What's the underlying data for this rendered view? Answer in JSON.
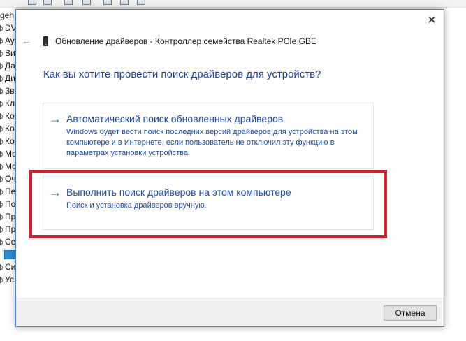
{
  "background": {
    "tree_items": [
      {
        "label": "gen",
        "icon": "none"
      },
      {
        "label": "DV",
        "icon": "chevron"
      },
      {
        "label": "Ay",
        "icon": "chevron"
      },
      {
        "label": "Ви",
        "icon": "chevron"
      },
      {
        "label": "Да",
        "icon": "chevron"
      },
      {
        "label": "Ди",
        "icon": "chevron"
      },
      {
        "label": "Зв",
        "icon": "chevron"
      },
      {
        "label": "Кл",
        "icon": "chevron"
      },
      {
        "label": "Ко",
        "icon": "chevron"
      },
      {
        "label": "Ко",
        "icon": "chevron"
      },
      {
        "label": "Ко",
        "icon": "chevron"
      },
      {
        "label": "Мо",
        "icon": "chevron"
      },
      {
        "label": "Мо",
        "icon": "chevron"
      },
      {
        "label": "Оч",
        "icon": "chevron"
      },
      {
        "label": "Пе",
        "icon": "chevron"
      },
      {
        "label": "По",
        "icon": "chevron"
      },
      {
        "label": "Пр",
        "icon": "chevron"
      },
      {
        "label": "Пр",
        "icon": "chevron"
      },
      {
        "label": "Се",
        "icon": "chevron"
      },
      {
        "label": "",
        "icon": "network-adapter-icon"
      },
      {
        "label": "Си",
        "icon": "chevron"
      },
      {
        "label": "Ус",
        "icon": "chevron"
      }
    ]
  },
  "dialog": {
    "title": "Обновление драйверов - Контроллер семейства Realtek PCIe GBE",
    "close_glyph": "✕",
    "back_glyph": "←",
    "question": "Как вы хотите провести поиск драйверов для устройств?",
    "options": [
      {
        "arrow": "→",
        "heading": "Автоматический поиск обновленных драйверов",
        "description": "Windows будет вести поиск последних версий драйверов для устройства на этом компьютере и в Интернете, если пользователь не отключил эту функцию в параметрах установки устройства."
      },
      {
        "arrow": "→",
        "heading": "Выполнить поиск драйверов на этом компьютере",
        "description": "Поиск и установка драйверов вручную."
      }
    ],
    "cancel_label": "Отмена"
  },
  "colors": {
    "link_blue": "#1a4aa8",
    "highlight_red": "#d4202a",
    "window_border": "#3a7bd5"
  }
}
